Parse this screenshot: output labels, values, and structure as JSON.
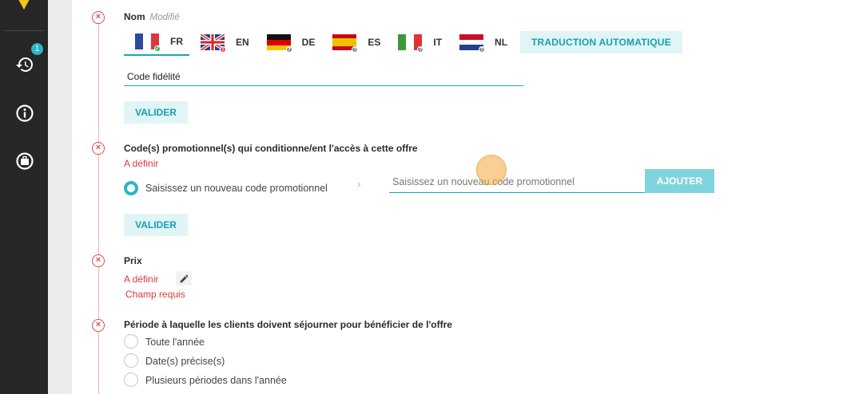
{
  "sidebar": {
    "history_badge": "1",
    "icons": [
      "history-icon",
      "info-icon",
      "luggage-icon"
    ]
  },
  "name_section": {
    "label": "Nom",
    "status": "Modifié",
    "tabs": [
      {
        "code": "FR",
        "status": "ok"
      },
      {
        "code": "EN",
        "status": "error"
      },
      {
        "code": "DE",
        "status": "unknown"
      },
      {
        "code": "ES",
        "status": "unknown"
      },
      {
        "code": "IT",
        "status": "unknown"
      },
      {
        "code": "NL",
        "status": "unknown"
      }
    ],
    "auto_translate": "TRADUCTION AUTOMATIQUE",
    "value": "Code fidélité",
    "validate": "VALIDER"
  },
  "promo_section": {
    "label": "Code(s) promotionnel(s) qui conditionne/ent l'accès à cette offre",
    "status": "A définir",
    "option": "Saisissez un nouveau code promotionnel",
    "placeholder": "Saisissez un nouveau code promotionnel",
    "add": "AJOUTER",
    "validate": "VALIDER"
  },
  "price_section": {
    "label": "Prix",
    "status": "A définir",
    "required": "Champ requis"
  },
  "period_section": {
    "label": "Période à laquelle les clients doivent séjourner pour bénéficier de l'offre",
    "options": [
      "Toute l'année",
      "Date(s) précise(s)",
      "Plusieurs périodes dans l'année"
    ]
  },
  "colors": {
    "accent": "#17a7b6",
    "error": "#d93a3a",
    "sidebar": "#262626"
  }
}
